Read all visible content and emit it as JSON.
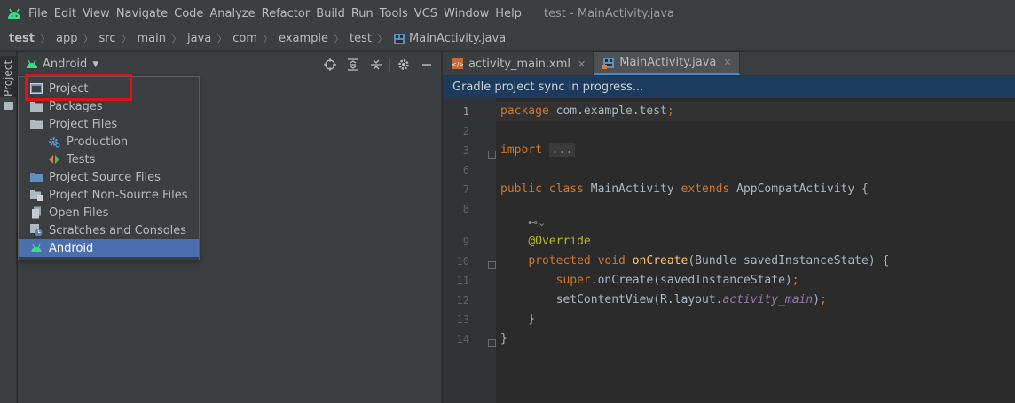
{
  "menubar": {
    "items": [
      "File",
      "Edit",
      "View",
      "Navigate",
      "Code",
      "Analyze",
      "Refactor",
      "Build",
      "Run",
      "Tools",
      "VCS",
      "Window",
      "Help"
    ],
    "title": "test - MainActivity.java"
  },
  "breadcrumb": [
    "test",
    "app",
    "src",
    "main",
    "java",
    "com",
    "example",
    "test",
    "MainActivity.java"
  ],
  "stripe": {
    "label": "Project"
  },
  "project_panel": {
    "view_selector": "Android",
    "view_options": [
      {
        "label": "Project",
        "icon": "project-icon",
        "indent": false,
        "selected": false
      },
      {
        "label": "Packages",
        "icon": "folder-icon",
        "indent": false,
        "selected": false
      },
      {
        "label": "Project Files",
        "icon": "folder-icon",
        "indent": false,
        "selected": false
      },
      {
        "label": "Production",
        "icon": "production-icon",
        "indent": true,
        "selected": false
      },
      {
        "label": "Tests",
        "icon": "tests-icon",
        "indent": true,
        "selected": false
      },
      {
        "label": "Project Source Files",
        "icon": "source-files-icon",
        "indent": false,
        "selected": false
      },
      {
        "label": "Project Non-Source Files",
        "icon": "non-source-files-icon",
        "indent": false,
        "selected": false
      },
      {
        "label": "Open Files",
        "icon": "open-files-icon",
        "indent": false,
        "selected": false
      },
      {
        "label": "Scratches and Consoles",
        "icon": "scratches-icon",
        "indent": false,
        "selected": false
      },
      {
        "label": "Android",
        "icon": "android-icon",
        "indent": false,
        "selected": true
      }
    ]
  },
  "editor": {
    "tabs": [
      {
        "label": "activity_main.xml",
        "active": false
      },
      {
        "label": "MainActivity.java",
        "active": true
      }
    ],
    "banner": "Gradle project sync in progress...",
    "line_numbers": [
      "1",
      "2",
      "3",
      "6",
      "7",
      "8",
      "",
      "9",
      "10",
      "11",
      "12",
      "13",
      "14"
    ]
  },
  "colors": {
    "accent": "#4b6eaf",
    "highlight_box": "#e3101a",
    "banner_bg": "#1d3b5c",
    "keyword": "#cc7832",
    "annotation": "#bbb529"
  }
}
